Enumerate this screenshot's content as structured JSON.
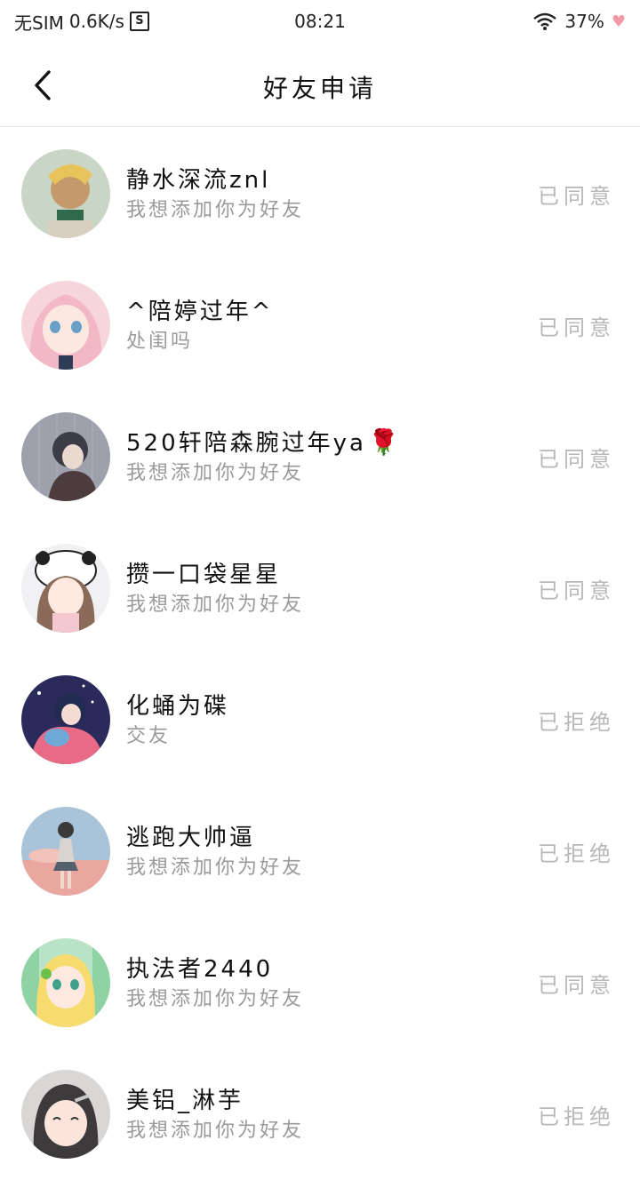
{
  "status_bar": {
    "carrier": "无SIM",
    "speed": "0.6K/s",
    "time": "08:21",
    "battery": "37%"
  },
  "header": {
    "title": "好友申请"
  },
  "colors": {
    "status_text": "#b8b8b8",
    "message_text": "#9a9a9a",
    "divider": "#e6e6e6"
  },
  "requests": [
    {
      "name": "静水深流znl",
      "message": "我想添加你为好友",
      "status": "已同意"
    },
    {
      "name": "^陪婷过年^",
      "message": "处闺吗",
      "status": "已同意"
    },
    {
      "name": "520轩陪森腕过年ya",
      "message": "我想添加你为好友",
      "status": "已同意",
      "emoji": "🌹"
    },
    {
      "name": "攒一口袋星星",
      "message": "我想添加你为好友",
      "status": "已同意"
    },
    {
      "name": "化蛹为碟",
      "message": "交友",
      "status": "已拒绝"
    },
    {
      "name": "逃跑大帅逼",
      "message": "我想添加你为好友",
      "status": "已拒绝"
    },
    {
      "name": "执法者2440",
      "message": "我想添加你为好友",
      "status": "已同意"
    },
    {
      "name": "美铝_淋芋",
      "message": "我想添加你为好友",
      "status": "已拒绝"
    }
  ]
}
